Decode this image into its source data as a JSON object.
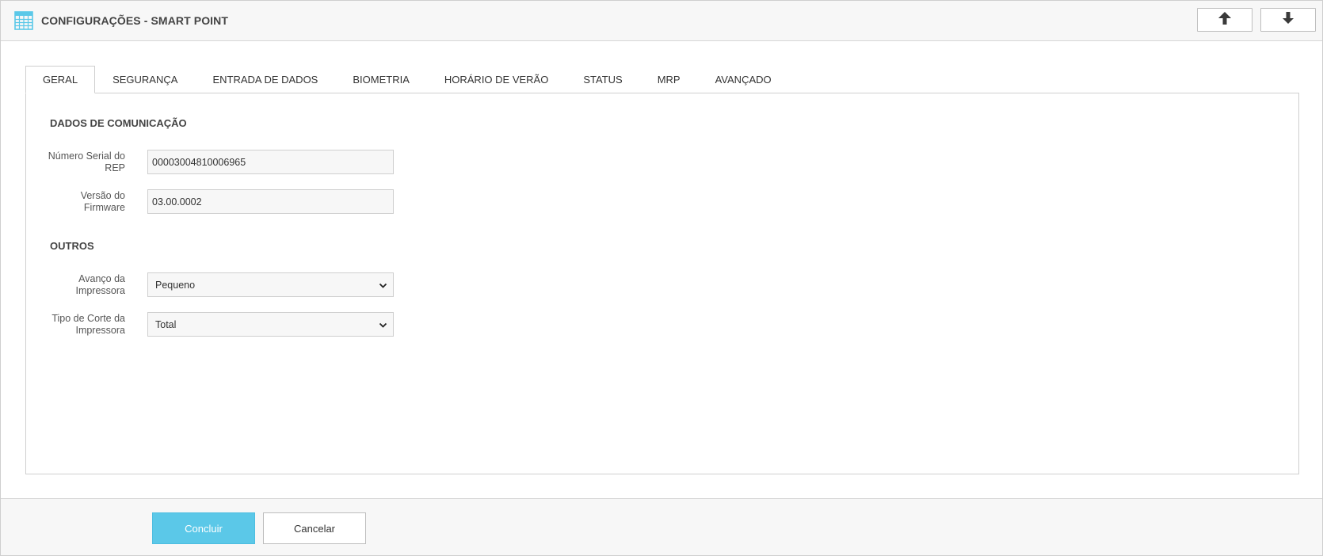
{
  "header": {
    "title": "CONFIGURAÇÕES - SMART POINT",
    "app_icon": "calculator-grid-icon",
    "nav_up_icon": "arrow-up-icon",
    "nav_down_icon": "arrow-down-icon"
  },
  "tabs": [
    {
      "label": "GERAL",
      "active": true
    },
    {
      "label": "SEGURANÇA",
      "active": false
    },
    {
      "label": "ENTRADA DE DADOS",
      "active": false
    },
    {
      "label": "BIOMETRIA",
      "active": false
    },
    {
      "label": "HORÁRIO DE VERÃO",
      "active": false
    },
    {
      "label": "STATUS",
      "active": false
    },
    {
      "label": "MRP",
      "active": false
    },
    {
      "label": "AVANÇADO",
      "active": false
    }
  ],
  "sections": {
    "comunicacao": {
      "title": "DADOS DE COMUNICAÇÃO",
      "serial_label": "Número Serial do REP",
      "serial_value": "00003004810006965",
      "firmware_label": "Versão do Firmware",
      "firmware_value": "03.00.0002"
    },
    "outros": {
      "title": "OUTROS",
      "avanco_label": "Avanço da Impressora",
      "avanco_value": "Pequeno",
      "corte_label": "Tipo de Corte da Impressora",
      "corte_value": "Total"
    }
  },
  "footer": {
    "confirm_label": "Concluir",
    "cancel_label": "Cancelar"
  },
  "colors": {
    "accent": "#5bc8e8",
    "icon": "#5bc8e8",
    "border": "#cfcfcf"
  }
}
